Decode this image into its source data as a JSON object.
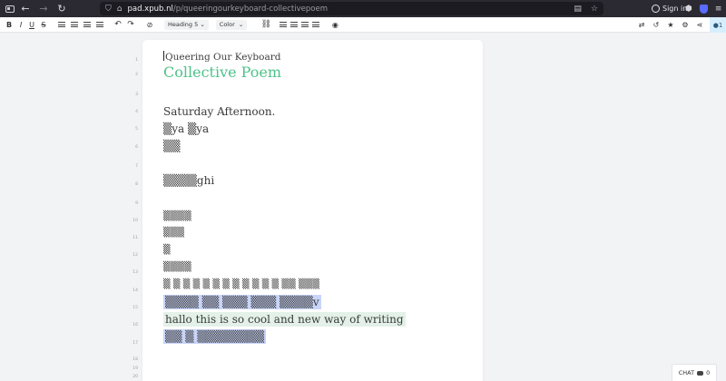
{
  "browser": {
    "url_host": "pad.xpub.nl",
    "url_path": "/p/queeringourkeyboard-collectivepoem",
    "signin_label": "Sign in",
    "icons": [
      "tab-icon",
      "back-arrow-icon",
      "forward-arrow-icon",
      "reload-icon",
      "shield-icon",
      "page-icon",
      "reader-icon",
      "star-icon",
      "account-icon",
      "shield-extension-icon",
      "extensions-icon",
      "menu-icon"
    ]
  },
  "toolbar": {
    "bold": "B",
    "italic": "I",
    "underline": "U",
    "strike": "S",
    "heading_select": "Heading 5",
    "color_select": "Color",
    "chevron": "⌄",
    "user_count": "1",
    "icons": [
      "bullet-list-icon",
      "ordered-list-icon",
      "indent-icon",
      "outdent-icon",
      "undo-icon",
      "redo-icon",
      "clear-format-icon",
      "link-icon",
      "align-left-icon",
      "align-center-icon",
      "align-right-icon",
      "align-justify-icon",
      "comment-icon",
      "import-export-icon",
      "history-icon",
      "star-icon",
      "settings-icon",
      "share-icon",
      "users-icon"
    ]
  },
  "gutter": [
    "1",
    "2",
    "3",
    "4",
    "5",
    "6",
    "7",
    "8",
    "9",
    "10",
    "11",
    "12",
    "13",
    "14",
    "15",
    "16",
    "17",
    "18",
    "19",
    "20"
  ],
  "document": {
    "line1": "Queering Our Keyboard",
    "line2": "Collective Poem",
    "line4": "Saturday Afternoon.",
    "line5": "▒ya ▒ya",
    "line6": "▒▒",
    "line8": "▒▒▒▒ghi",
    "line10": "▒▒▒▒",
    "line11": "▒▒▒",
    "line12": "▒",
    "line13": "▒▒▒▒",
    "line14": "▒ ▒ ▒ ▒ ▒ ▒ ▒ ▒ ▒ ▒ ▒ ▒ ▒▒ ▒▒▒",
    "line15": "▒▒▒▒ ▒▒ ▒▒▒ ▒▒▒ ▒▒▒▒v",
    "line16": "hallo this is so cool and new way of writing",
    "line17": "▒▒ ▒ ▒▒▒▒▒▒▒▒"
  },
  "chat": {
    "label": "CHAT",
    "count": "0"
  },
  "colors": {
    "title_green": "#4ec38a",
    "highlight_blue": "#c8d4f8",
    "highlight_green": "#e3f1e8"
  }
}
